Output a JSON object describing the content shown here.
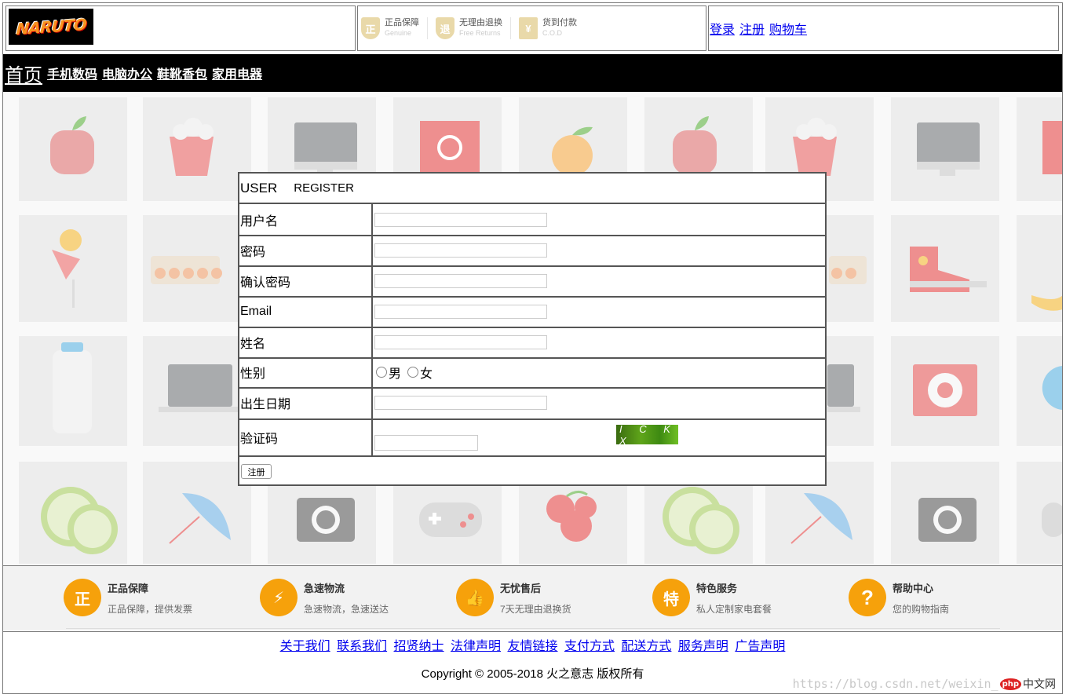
{
  "header": {
    "logo_text": "NARUTO",
    "promises": [
      {
        "icon": "genuine-shield-icon",
        "glyph": "正",
        "title": "正品保障",
        "sub": "Genuine"
      },
      {
        "icon": "return-shield-icon",
        "glyph": "退",
        "title": "无理由退换",
        "sub": "Free Returns"
      },
      {
        "icon": "cod-icon",
        "glyph": "¥",
        "title": "货到付款",
        "sub": "C.O.D"
      }
    ],
    "links": {
      "login": "登录",
      "register": "注册",
      "cart": "购物车"
    }
  },
  "nav": {
    "home": "首页",
    "categories": [
      "手机数码",
      "电脑办公",
      "鞋靴香包",
      "家用电器"
    ]
  },
  "form": {
    "title_user": "USER",
    "title_register": "REGISTER",
    "fields": {
      "username": "用户名",
      "password": "密码",
      "confirm": "确认密码",
      "email": "Email",
      "name": "姓名",
      "gender": "性别",
      "birthday": "出生日期",
      "captcha": "验证码"
    },
    "gender_options": {
      "male": "男",
      "female": "女"
    },
    "captcha_text": "I C K X",
    "submit": "注册"
  },
  "services": [
    {
      "icon": "genuine-icon",
      "glyph": "正",
      "title": "正品保障",
      "desc": "正品保障，提供发票"
    },
    {
      "icon": "delivery-icon",
      "glyph": "⚡",
      "title": "急速物流",
      "desc": "急速物流，急速送达"
    },
    {
      "icon": "thumbs-up-icon",
      "glyph": "👍",
      "title": "无忧售后",
      "desc": "7天无理由退换货"
    },
    {
      "icon": "special-service-icon",
      "glyph": "特",
      "title": "特色服务",
      "desc": "私人定制家电套餐"
    },
    {
      "icon": "help-icon",
      "glyph": "?",
      "title": "帮助中心",
      "desc": "您的购物指南"
    }
  ],
  "footer": {
    "links": [
      "关于我们",
      "联系我们",
      "招贤纳士",
      "法律声明",
      "友情链接",
      "支付方式",
      "配送方式",
      "服务声明",
      "广告声明"
    ],
    "copyright": "Copyright © 2005-2018 火之意志 版权所有",
    "watermark": "https://blog.csdn.net/weixin_",
    "badge_php": "php",
    "badge_text": "中文网"
  },
  "colors": {
    "accent": "#f6a10b",
    "nav_bg": "#000000",
    "link": "#0000ee"
  }
}
